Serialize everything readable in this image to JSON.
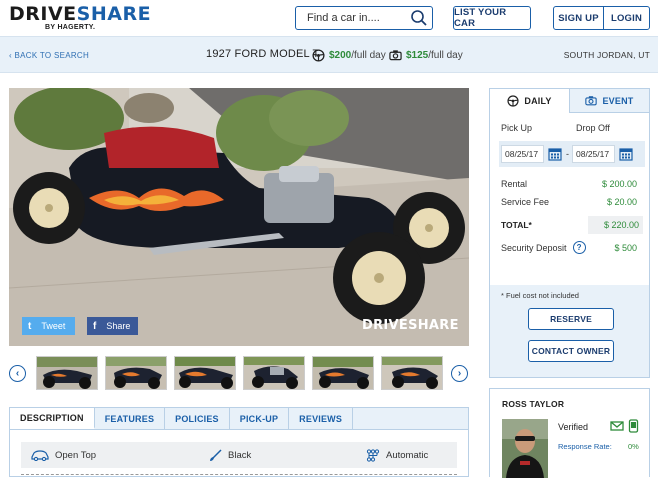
{
  "header": {
    "logo_main_a": "DRIVE",
    "logo_main_b": "SHARE",
    "logo_sub": "BY HAGERTY.",
    "search_placeholder": "Find a car in....",
    "list_car_label": "LIST YOUR CAR",
    "signup_label": "SIGN UP",
    "login_label": "LOGIN"
  },
  "subbar": {
    "back_label": "BACK TO SEARCH",
    "car_title": "1927 FORD MODEL T",
    "day_price": "$200",
    "day_suffix": "/full day",
    "full_price": "$125",
    "full_suffix": "/full day",
    "location": "SOUTH JORDAN, UT"
  },
  "photo": {
    "share_twitter": "Tweet",
    "share_facebook": "Share",
    "watermark": "DRIVESHARE"
  },
  "thumbnails_count": 6,
  "details": {
    "tabs": [
      "DESCRIPTION",
      "FEATURES",
      "POLICIES",
      "PICK-UP",
      "REVIEWS"
    ],
    "active_tab": "DESCRIPTION",
    "features": [
      {
        "icon": "car-icon",
        "label": "Open Top"
      },
      {
        "icon": "paintbrush-icon",
        "label": "Black"
      },
      {
        "icon": "gearshift-icon",
        "label": "Automatic"
      }
    ]
  },
  "booking": {
    "tab_daily": "DAILY",
    "tab_event": "EVENT",
    "pickup_label": "Pick Up",
    "dropoff_label": "Drop Off",
    "pickup_date": "08/25/17",
    "dropoff_date": "08/25/17",
    "date_separator": "-",
    "rental_label": "Rental",
    "rental_value": "$ 200.00",
    "service_label": "Service Fee",
    "service_value": "$ 20.00",
    "total_label": "TOTAL*",
    "total_value": "$ 220.00",
    "deposit_label": "Security Deposit",
    "deposit_value": "$ 500",
    "fuel_note": "* Fuel cost not included",
    "reserve_label": "RESERVE",
    "contact_label": "CONTACT OWNER"
  },
  "owner": {
    "name": "ROSS TAYLOR",
    "verified_label": "Verified",
    "response_label": "Response Rate:",
    "response_value": "0%"
  },
  "colors": {
    "brand_blue": "#1a5fa8",
    "price_green": "#2e8b3a",
    "panel_bg": "#e8f1f9"
  }
}
